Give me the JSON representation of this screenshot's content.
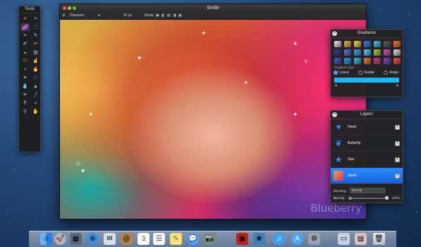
{
  "tools_panel": {
    "title": "Tools",
    "tools": [
      "arrow-select",
      "arrow-direct",
      "lasso",
      "marquee",
      "crop",
      "eyedropper",
      "brush",
      "pencil",
      "eraser",
      "bucket",
      "clone",
      "heal",
      "blur",
      "dodge",
      "burn",
      "sponge",
      "sharpen",
      "smudge",
      "pen",
      "line",
      "text",
      "shape",
      "zoom",
      "hand"
    ]
  },
  "window": {
    "title": "Smile",
    "toolbar": {
      "diameter_label": "Diameter:",
      "diameter_value": "55 px",
      "mode_label": "Mode:"
    },
    "watermark": "Blueberry"
  },
  "gradients_panel": {
    "title": "Gradients",
    "type_label": "Gradient Type",
    "types": [
      "Linear",
      "Radial",
      "Angle"
    ],
    "selected_type": "Linear",
    "swatches": [
      "#f2f2f2",
      "#f0b84a",
      "#f8e04a",
      "#3a7de8",
      "#4ec6e0",
      "#5b5b5b",
      "#ff7a2a",
      "#2c3f8e",
      "#4f7adf",
      "#37a8ef",
      "#5ad2ff",
      "#a6d44a",
      "#d94fb6",
      "#e8e8e8",
      "#3a5fc8",
      "#2a9cf0",
      "#27c7e8",
      "#f07a3a",
      "#d83c8c",
      "#8f3fd0",
      "#ff4a4a"
    ],
    "selected_gradient_color": "#19b9f5"
  },
  "layers_panel": {
    "title": "Layers",
    "layers": [
      {
        "name": "Heart",
        "icon": "heart-icon"
      },
      {
        "name": "Butterfly",
        "icon": "butterfly-icon"
      },
      {
        "name": "Star",
        "icon": "star-icon"
      },
      {
        "name": "Smile",
        "icon": "photo-thumbnail",
        "selected": true
      }
    ],
    "blending_label": "Blending:",
    "blending_value": "Normal",
    "opacity_label": "Opacity:",
    "opacity_value": "100%"
  },
  "dock": {
    "apps": [
      "finder",
      "launchpad",
      "mission-control",
      "safari",
      "mail",
      "contacts",
      "calendar",
      "reminders",
      "notes",
      "messages",
      "facetime",
      "photo-booth",
      "iphoto",
      "itunes",
      "app-store",
      "system-preferences",
      "downloads",
      "documents",
      "trash"
    ]
  }
}
